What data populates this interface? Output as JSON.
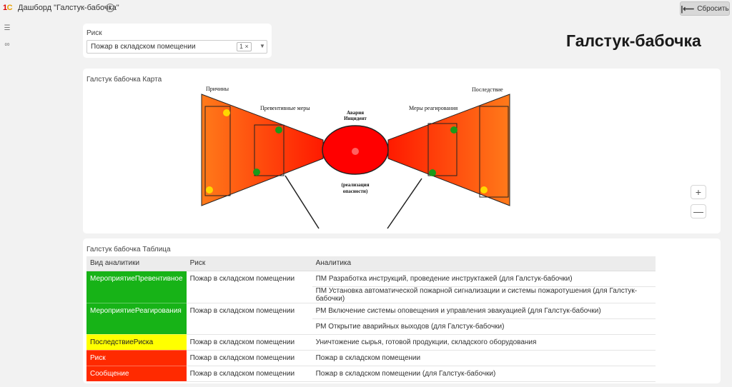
{
  "header": {
    "logo": "1С",
    "title": "Дашборд \"Галстук-бабочка\"",
    "info_icon": "info-icon",
    "reset_label": "Сбросить"
  },
  "sidebar": {
    "icons": [
      "list-icon",
      "infinity-icon"
    ]
  },
  "risk_filter": {
    "label": "Риск",
    "value": "Пожар в складском помещении",
    "count": "1 ×"
  },
  "page_title": "Галстук-бабочка",
  "map": {
    "title": "Галстук бабочка Карта",
    "labels": {
      "causes": "Причины",
      "preventive": "Превентивные меры",
      "accident_line1": "Авария",
      "accident_line2": "Инцидент",
      "response": "Меры реагирования",
      "consequence": "Последствие",
      "realization_line1": "(реализация",
      "realization_line2": "опасности)"
    },
    "zoom_in": "+",
    "zoom_out": "—",
    "colors": {
      "wing_outer": "#ff7a1a",
      "wing_inner": "#ff1a00",
      "center": "#ff0000",
      "green_dot": "#1a9a1a",
      "yellow_dot": "#ffd700"
    }
  },
  "table": {
    "title": "Галстук бабочка Таблица",
    "headers": [
      "Вид аналитики",
      "Риск",
      "Аналитика"
    ],
    "rows": [
      {
        "kind": "МероприятиеПревентивное",
        "risk": "Пожар в складском помещении",
        "color": "#17b317",
        "text_color": "#ffffff",
        "items": [
          "ПМ Разработка инструкций, проведение инструктажей (для Галстук-бабочки)",
          "ПМ Установка автоматической пожарной сигнализации и системы пожаротушения (для Галстук-бабочки)"
        ]
      },
      {
        "kind": "МероприятиеРеагирования",
        "risk": "Пожар в складском помещении",
        "color": "#17b317",
        "text_color": "#ffffff",
        "items": [
          "РМ Включение системы оповещения и управления эвакуацией (для Галстук-бабочки)",
          "РМ Открытие аварийных выходов (для Галстук-бабочки)"
        ]
      },
      {
        "kind": "ПоследствиеРиска",
        "risk": "Пожар в складском помещении",
        "color": "#ffff00",
        "text_color": "#222222",
        "items": [
          "Уничтожение сырья, готовой продукции, складского оборудования"
        ]
      },
      {
        "kind": "Риск",
        "risk": "Пожар в складском помещении",
        "color": "#ff2a00",
        "text_color": "#ffffff",
        "items": [
          "Пожар в складском помещении"
        ]
      },
      {
        "kind": "Сообщение",
        "risk": "Пожар в складском помещении",
        "color": "#ff2a00",
        "text_color": "#ffffff",
        "items": [
          "Пожар в складском помещении (для Галстук-бабочки)"
        ]
      }
    ]
  }
}
